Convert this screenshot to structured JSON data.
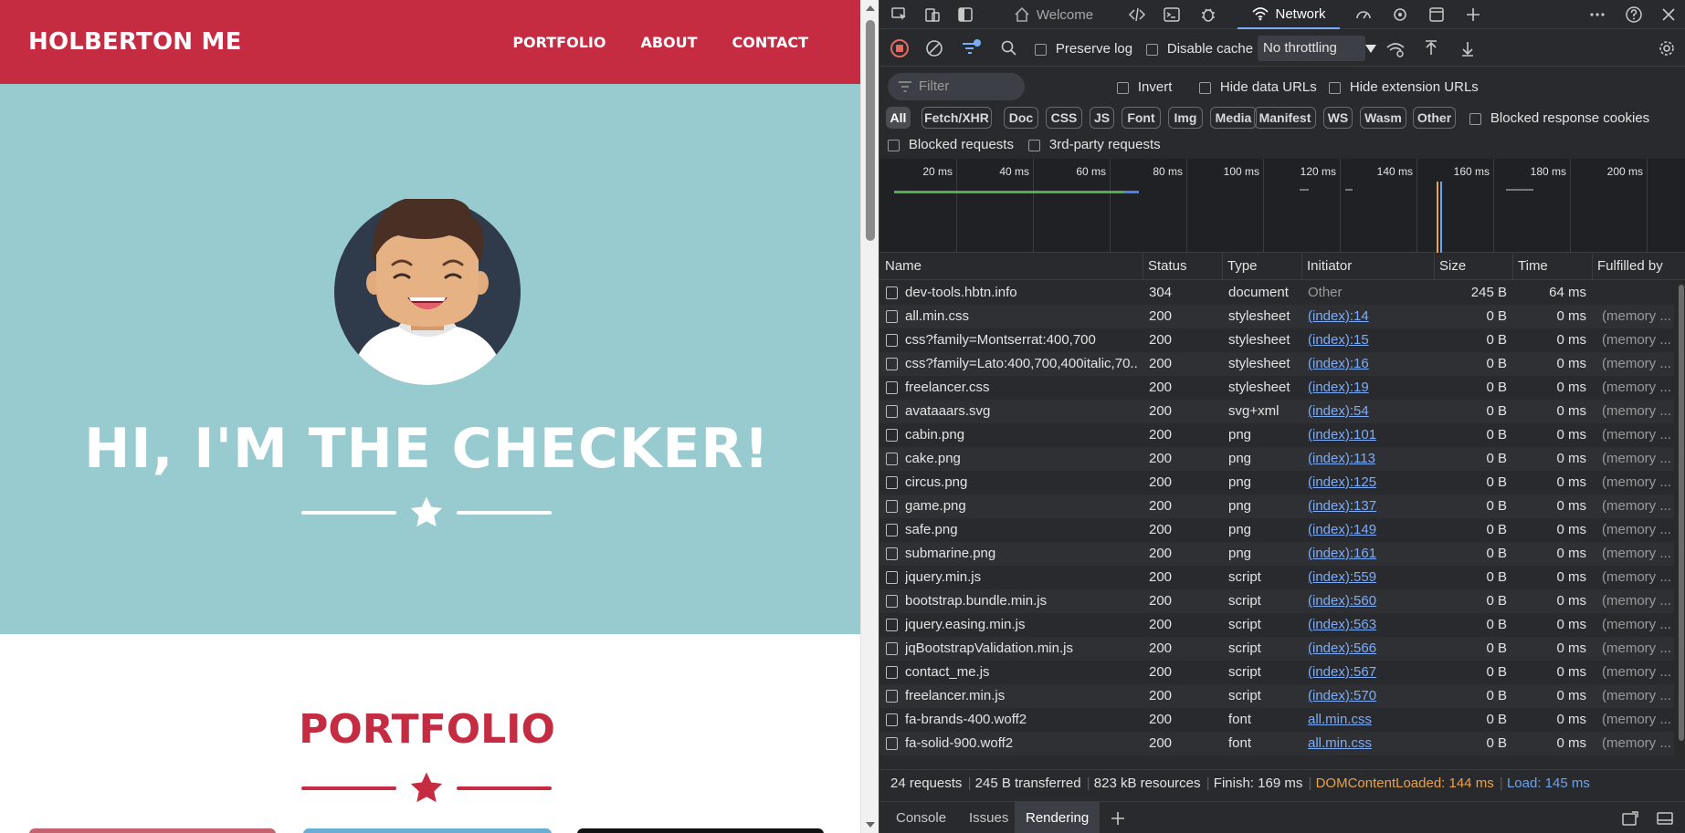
{
  "site": {
    "brand": "HOLBERTON ME",
    "nav": [
      "PORTFOLIO",
      "ABOUT",
      "CONTACT"
    ],
    "hero_title": "HI, I'M THE CHECKER!",
    "section_title": "PORTFOLIO",
    "colors": {
      "primary": "#c52b41",
      "hero_bg": "#97cbcf"
    }
  },
  "devtools": {
    "tabs": {
      "welcome": "Welcome",
      "network": "Network"
    },
    "toolbar": {
      "preserve_log": "Preserve log",
      "disable_cache": "Disable cache",
      "throttling": "No throttling"
    },
    "filter": {
      "placeholder": "Filter",
      "invert": "Invert",
      "hide_data_urls": "Hide data URLs",
      "hide_extension_urls": "Hide extension URLs",
      "chips": [
        "All",
        "Fetch/XHR",
        "Doc",
        "CSS",
        "JS",
        "Font",
        "Img",
        "Media",
        "Manifest",
        "WS",
        "Wasm",
        "Other"
      ],
      "blocked_response_cookies": "Blocked response cookies",
      "blocked_requests": "Blocked requests",
      "third_party": "3rd-party requests"
    },
    "timeline_ticks": [
      "20 ms",
      "40 ms",
      "60 ms",
      "80 ms",
      "100 ms",
      "120 ms",
      "140 ms",
      "160 ms",
      "180 ms",
      "200 ms"
    ],
    "columns": [
      "Name",
      "Status",
      "Type",
      "Initiator",
      "Size",
      "Time",
      "Fulfilled by"
    ],
    "requests": [
      {
        "name": "dev-tools.hbtn.info",
        "status": "304",
        "type": "document",
        "initiator": "Other",
        "size": "245 B",
        "time": "64 ms",
        "fulfilled": "",
        "icon": "document-icon"
      },
      {
        "name": "all.min.css",
        "status": "200",
        "type": "stylesheet",
        "initiator": "(index):14",
        "size": "0 B",
        "time": "0 ms",
        "fulfilled": "(memory ...",
        "icon": "stylesheet-icon"
      },
      {
        "name": "css?family=Montserrat:400,700",
        "status": "200",
        "type": "stylesheet",
        "initiator": "(index):15",
        "size": "0 B",
        "time": "0 ms",
        "fulfilled": "(memory ...",
        "icon": "stylesheet-icon"
      },
      {
        "name": "css?family=Lato:400,700,400italic,70...",
        "status": "200",
        "type": "stylesheet",
        "initiator": "(index):16",
        "size": "0 B",
        "time": "0 ms",
        "fulfilled": "(memory ...",
        "icon": "stylesheet-icon"
      },
      {
        "name": "freelancer.css",
        "status": "200",
        "type": "stylesheet",
        "initiator": "(index):19",
        "size": "0 B",
        "time": "0 ms",
        "fulfilled": "(memory ...",
        "icon": "stylesheet-icon"
      },
      {
        "name": "avataaars.svg",
        "status": "200",
        "type": "svg+xml",
        "initiator": "(index):54",
        "size": "0 B",
        "time": "0 ms",
        "fulfilled": "(memory ...",
        "icon": "image-icon"
      },
      {
        "name": "cabin.png",
        "status": "200",
        "type": "png",
        "initiator": "(index):101",
        "size": "0 B",
        "time": "0 ms",
        "fulfilled": "(memory ...",
        "icon": "image-icon"
      },
      {
        "name": "cake.png",
        "status": "200",
        "type": "png",
        "initiator": "(index):113",
        "size": "0 B",
        "time": "0 ms",
        "fulfilled": "(memory ...",
        "icon": "image-icon"
      },
      {
        "name": "circus.png",
        "status": "200",
        "type": "png",
        "initiator": "(index):125",
        "size": "0 B",
        "time": "0 ms",
        "fulfilled": "(memory ...",
        "icon": "image-icon"
      },
      {
        "name": "game.png",
        "status": "200",
        "type": "png",
        "initiator": "(index):137",
        "size": "0 B",
        "time": "0 ms",
        "fulfilled": "(memory ...",
        "icon": "image-icon"
      },
      {
        "name": "safe.png",
        "status": "200",
        "type": "png",
        "initiator": "(index):149",
        "size": "0 B",
        "time": "0 ms",
        "fulfilled": "(memory ...",
        "icon": "image-icon"
      },
      {
        "name": "submarine.png",
        "status": "200",
        "type": "png",
        "initiator": "(index):161",
        "size": "0 B",
        "time": "0 ms",
        "fulfilled": "(memory ...",
        "icon": "image-icon"
      },
      {
        "name": "jquery.min.js",
        "status": "200",
        "type": "script",
        "initiator": "(index):559",
        "size": "0 B",
        "time": "0 ms",
        "fulfilled": "(memory ...",
        "icon": "script-icon"
      },
      {
        "name": "bootstrap.bundle.min.js",
        "status": "200",
        "type": "script",
        "initiator": "(index):560",
        "size": "0 B",
        "time": "0 ms",
        "fulfilled": "(memory ...",
        "icon": "script-icon"
      },
      {
        "name": "jquery.easing.min.js",
        "status": "200",
        "type": "script",
        "initiator": "(index):563",
        "size": "0 B",
        "time": "0 ms",
        "fulfilled": "(memory ...",
        "icon": "script-icon"
      },
      {
        "name": "jqBootstrapValidation.min.js",
        "status": "200",
        "type": "script",
        "initiator": "(index):566",
        "size": "0 B",
        "time": "0 ms",
        "fulfilled": "(memory ...",
        "icon": "script-icon"
      },
      {
        "name": "contact_me.js",
        "status": "200",
        "type": "script",
        "initiator": "(index):567",
        "size": "0 B",
        "time": "0 ms",
        "fulfilled": "(memory ...",
        "icon": "script-icon"
      },
      {
        "name": "freelancer.min.js",
        "status": "200",
        "type": "script",
        "initiator": "(index):570",
        "size": "0 B",
        "time": "0 ms",
        "fulfilled": "(memory ...",
        "icon": "script-icon"
      },
      {
        "name": "fa-brands-400.woff2",
        "status": "200",
        "type": "font",
        "initiator": "all.min.css",
        "size": "0 B",
        "time": "0 ms",
        "fulfilled": "(memory ...",
        "icon": "font-icon"
      },
      {
        "name": "fa-solid-900.woff2",
        "status": "200",
        "type": "font",
        "initiator": "all.min.css",
        "size": "0 B",
        "time": "0 ms",
        "fulfilled": "(memory ...",
        "icon": "font-icon"
      }
    ],
    "summary": {
      "requests": "24 requests",
      "transferred": "245 B transferred",
      "resources": "823 kB resources",
      "finish": "Finish: 169 ms",
      "dom_loaded": "DOMContentLoaded: 144 ms",
      "load": "Load: 145 ms"
    },
    "drawer_tabs": [
      "Console",
      "Issues",
      "Rendering"
    ]
  }
}
